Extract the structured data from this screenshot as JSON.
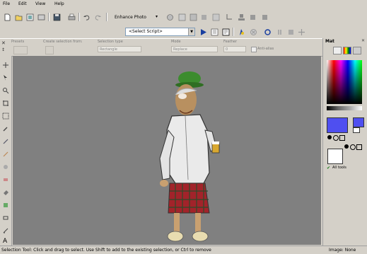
{
  "menu": [
    "File",
    "Edit",
    "View",
    "Help"
  ],
  "toolbar1": {
    "enhance_label": "Enhance Photo"
  },
  "toolbar2": {
    "script_select": "<Select Script>"
  },
  "options": {
    "presets_label": "Presets",
    "create_selection_label": "Create selection from:",
    "selection_type_label": "Selection type",
    "selection_type_value": "Rectangle",
    "mode_label": "Mode",
    "mode_value": "Replace",
    "feather_label": "Feather",
    "feather_value": "0",
    "antialias_label": "Anti-alias"
  },
  "palette": {
    "title": "Mat",
    "all_tools_label": "All tools"
  },
  "status": {
    "hint": "Selection Tool: Click and drag to select. Use Shift to add to the existing selection, or Ctrl to remove",
    "image": "Image: None"
  },
  "colors": {
    "fg_swatch": "#4f4ff0",
    "canvas": "#808080"
  },
  "icons": {
    "select": "selection-icon",
    "pan": "pan-icon",
    "zoom": "zoom-icon"
  }
}
